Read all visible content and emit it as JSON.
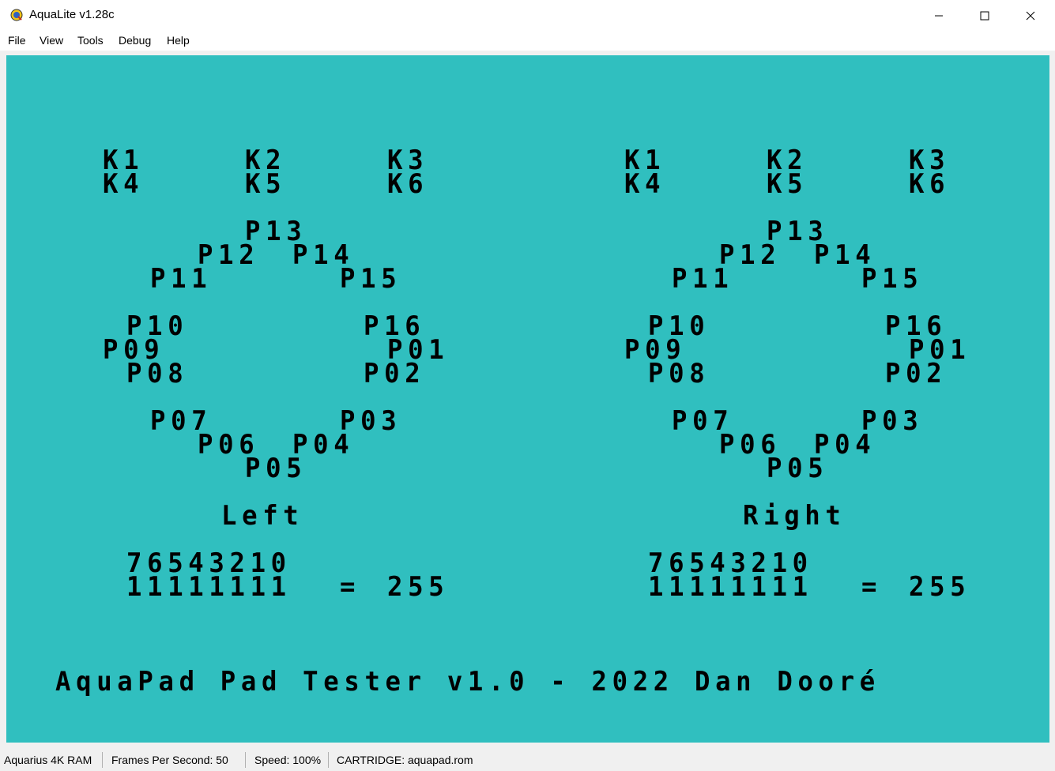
{
  "window": {
    "title": "AquaLite v1.28c",
    "icons": {
      "app": "aqualite-logo-icon",
      "minimize": "minimize-icon",
      "maximize": "maximize-icon",
      "close": "close-icon"
    }
  },
  "menu": {
    "file": "File",
    "view": "View",
    "tools": "Tools",
    "debug": "Debug",
    "help": "Help"
  },
  "screen": {
    "background": "#30bfbf",
    "left": {
      "k1": "K1",
      "k2": "K2",
      "k3": "K3",
      "k4": "K4",
      "k5": "K5",
      "k6": "K6",
      "p13": "P13",
      "p12": "P12",
      "p14": "P14",
      "p11": "P11",
      "p15": "P15",
      "p10": "P10",
      "p16": "P16",
      "p09": "P09",
      "p01": "P01",
      "p08": "P08",
      "p02": "P02",
      "p07": "P07",
      "p03": "P03",
      "p06": "P06",
      "p04": "P04",
      "p05": "P05",
      "label": "Left",
      "bits_header": "76543210",
      "bits": "11111111",
      "equals": "=",
      "value": "255"
    },
    "right": {
      "k1": "K1",
      "k2": "K2",
      "k3": "K3",
      "k4": "K4",
      "k5": "K5",
      "k6": "K6",
      "p13": "P13",
      "p12": "P12",
      "p14": "P14",
      "p11": "P11",
      "p15": "P15",
      "p10": "P10",
      "p16": "P16",
      "p09": "P09",
      "p01": "P01",
      "p08": "P08",
      "p02": "P02",
      "p07": "P07",
      "p03": "P03",
      "p06": "P06",
      "p04": "P04",
      "p05": "P05",
      "label": "Right",
      "bits_header": "76543210",
      "bits": "11111111",
      "equals": "=",
      "value": "255"
    },
    "footer": "AquaPad Pad Tester v1.0 - 2022 Dan Dooré"
  },
  "status": {
    "ram": "Aquarius 4K RAM",
    "fps": "Frames Per Second: 50",
    "speed": "Speed: 100%",
    "cartridge": "CARTRIDGE: aquapad.rom"
  }
}
